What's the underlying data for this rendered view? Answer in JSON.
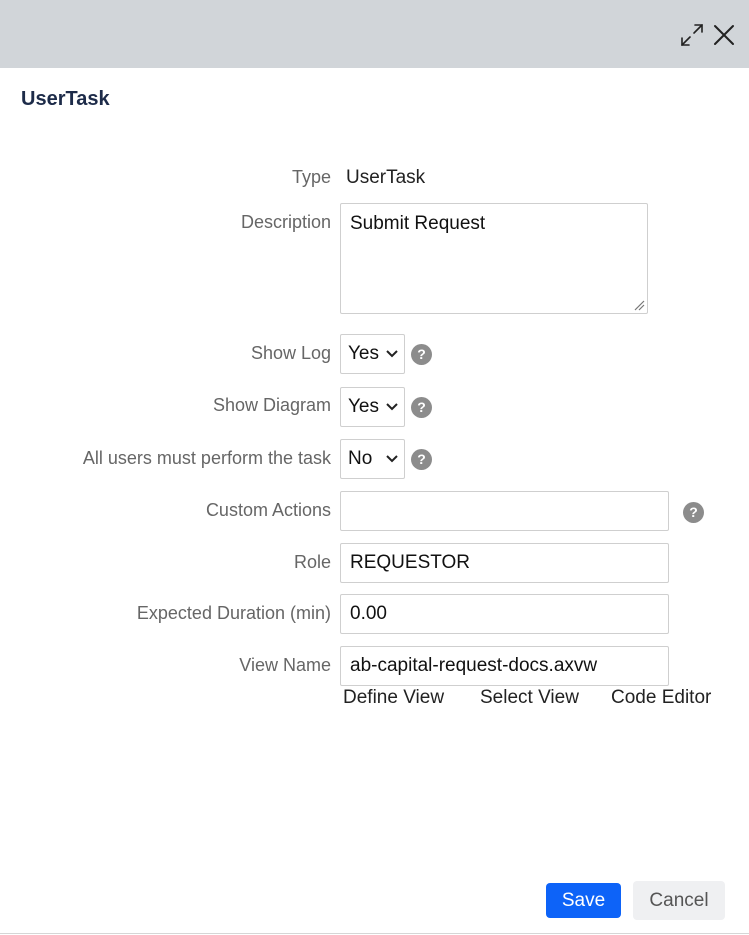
{
  "header": {
    "expand_icon": "expand-diagonal-arrows-icon",
    "close_icon": "close-x-icon",
    "background": "#d1d5d9"
  },
  "dialog": {
    "title": "UserTask"
  },
  "form": {
    "type": {
      "label": "Type",
      "value": "UserTask"
    },
    "description": {
      "label": "Description",
      "value": "Submit Request"
    },
    "show_log": {
      "label": "Show Log",
      "value": "Yes"
    },
    "show_diagram": {
      "label": "Show Diagram",
      "value": "Yes"
    },
    "all_users": {
      "label": "All users must perform the task",
      "value": "No"
    },
    "custom_actions": {
      "label": "Custom Actions",
      "value": ""
    },
    "role": {
      "label": "Role",
      "value": "REQUESTOR"
    },
    "expected_duration": {
      "label": "Expected Duration (min)",
      "value": "0.00"
    },
    "view_name": {
      "label": "View Name",
      "value": "ab-capital-request-docs.axvw"
    },
    "help_glyph": "?"
  },
  "view_links": {
    "define": "Define View",
    "select": "Select View",
    "code_editor": "Code Editor"
  },
  "footer": {
    "save_label": "Save",
    "cancel_label": "Cancel",
    "save_color": "#0d63f8"
  }
}
